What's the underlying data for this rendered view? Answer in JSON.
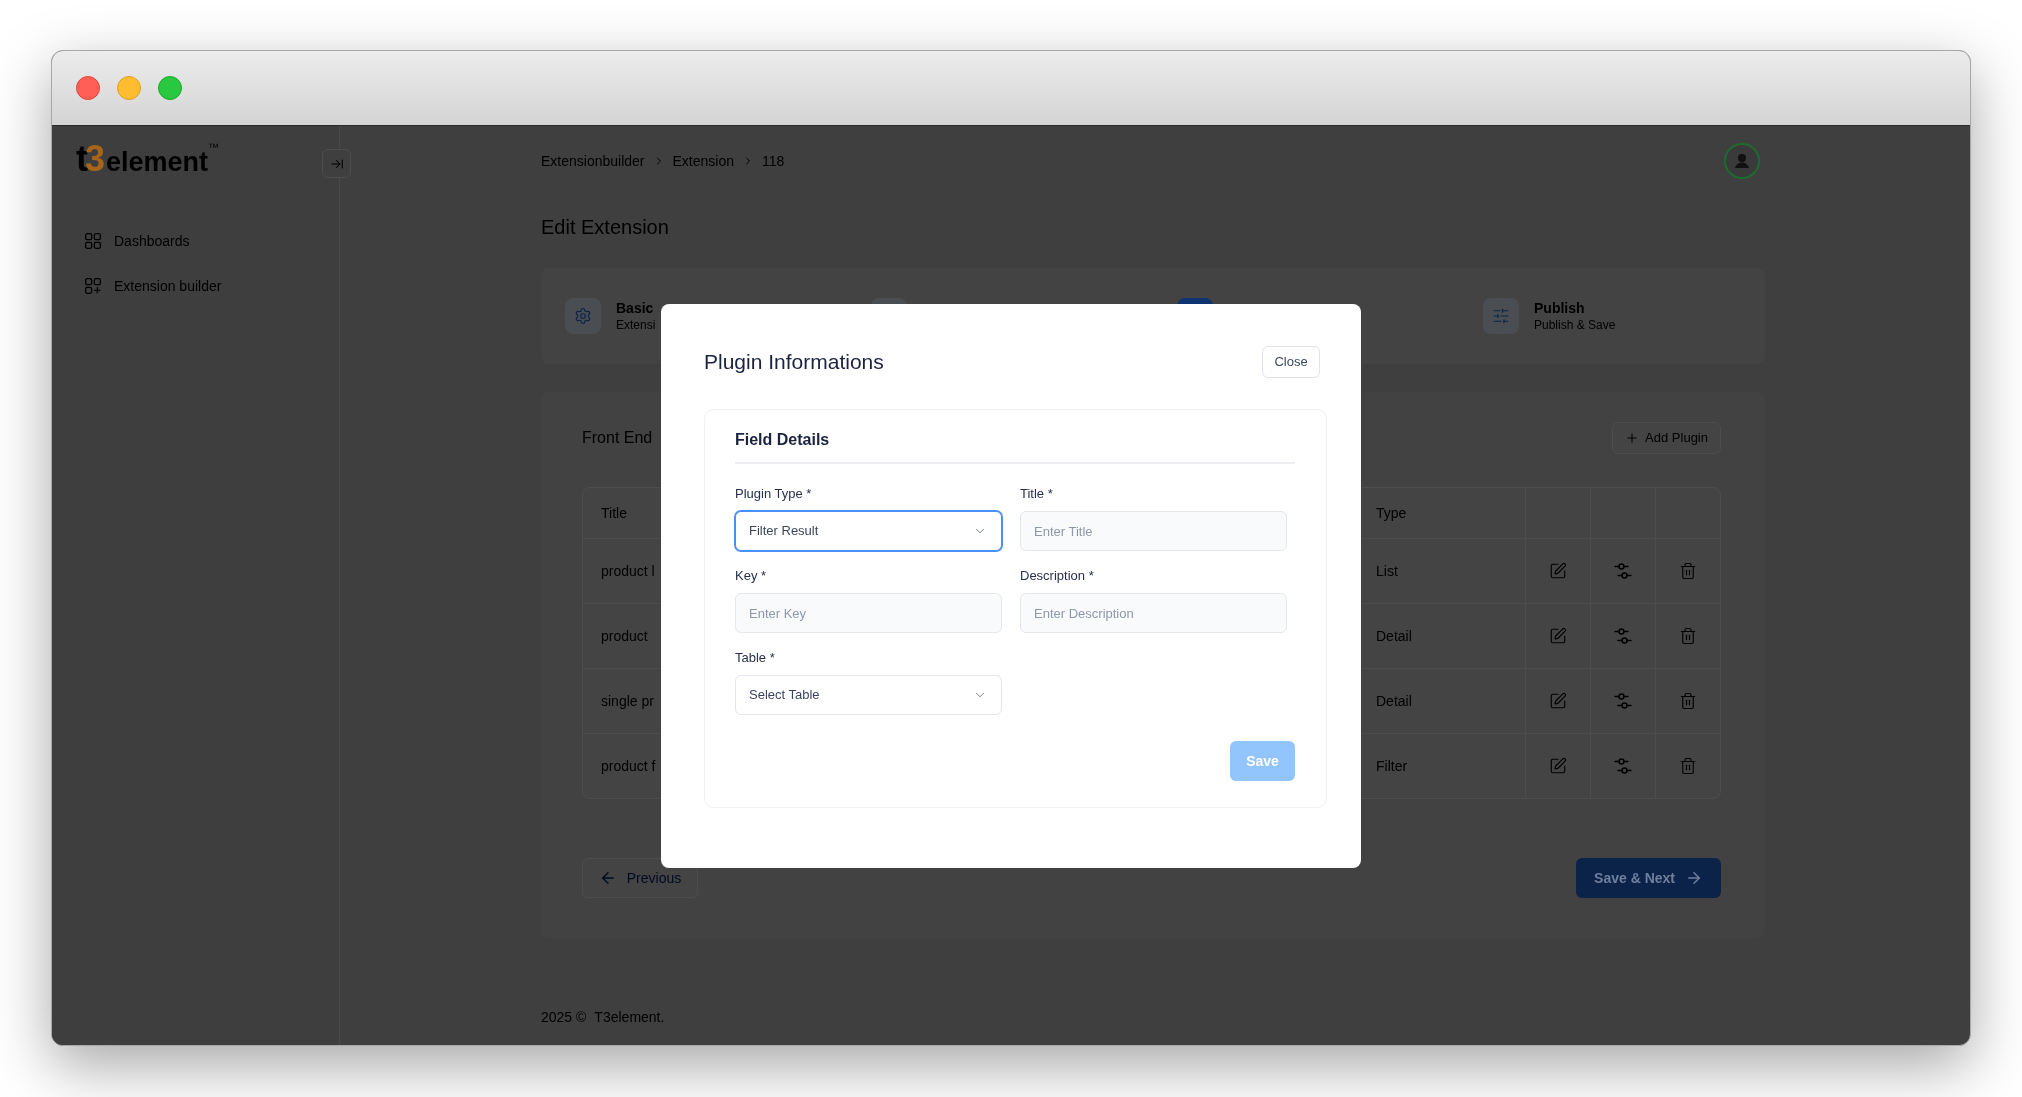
{
  "sidebar": {
    "logo": {
      "mark": "t3",
      "name": "element",
      "trademark": "™"
    },
    "items": [
      {
        "label": "Dashboards"
      },
      {
        "label": "Extension builder"
      }
    ]
  },
  "header": {
    "breadcrumb": [
      "Extensionbuilder",
      "Extension",
      "118"
    ]
  },
  "page_title": "Edit Extension",
  "steps": [
    {
      "title": "Basic",
      "subtitle": "Extensi",
      "selected": false
    },
    {
      "selected": false
    },
    {
      "selected": true
    },
    {
      "title": "Publish",
      "subtitle": "Publish & Save",
      "selected": false
    }
  ],
  "plugins": {
    "title": "Front End",
    "add_button": "Add Plugin",
    "table": {
      "columns": [
        "Title",
        "Type"
      ],
      "rows": [
        {
          "title": "product l",
          "type": "List"
        },
        {
          "title": "product",
          "type": "Detail"
        },
        {
          "title": "single pr",
          "type": "Detail"
        },
        {
          "title": "product f",
          "type": "Filter"
        }
      ]
    }
  },
  "navigation": {
    "previous": "Previous",
    "next": "Save & Next"
  },
  "footer": {
    "copyright": "2025 ©",
    "brand": "T3element."
  },
  "modal": {
    "title": "Plugin Informations",
    "close": "Close",
    "section": "Field Details",
    "fields": [
      {
        "label": "Plugin Type *",
        "kind": "select",
        "value": "Filter Result",
        "focused": true
      },
      {
        "label": "Title *",
        "kind": "input",
        "placeholder": "Enter Title",
        "focused": false
      },
      {
        "label": "Key *",
        "kind": "input",
        "placeholder": "Enter Key",
        "focused": false
      },
      {
        "label": "Description *",
        "kind": "input",
        "placeholder": "Enter Description",
        "focused": false
      },
      {
        "label": "Table *",
        "kind": "select",
        "value": "Select Table",
        "focused": false
      }
    ],
    "save": {
      "label": "Save",
      "disabled": true
    }
  }
}
